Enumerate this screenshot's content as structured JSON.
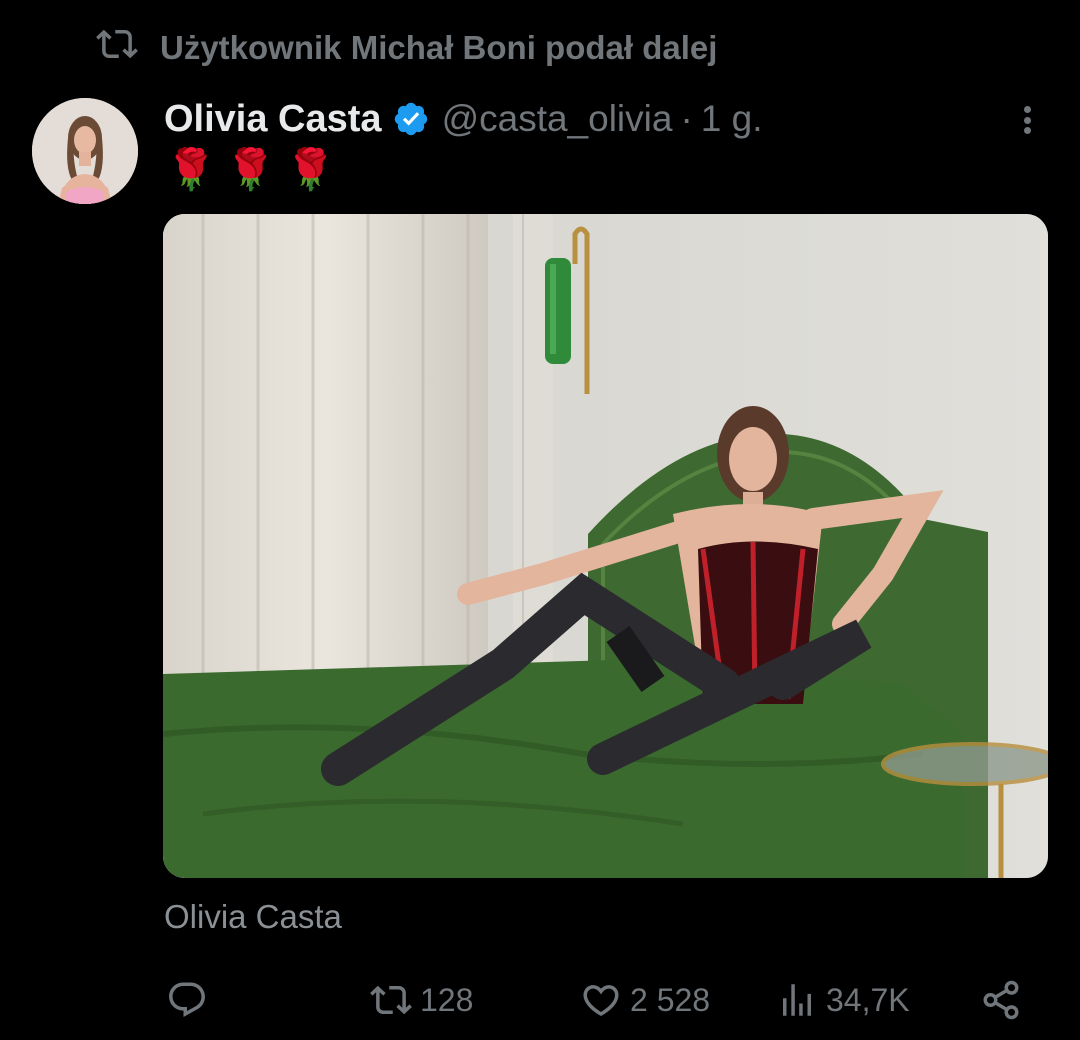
{
  "retweet": {
    "icon": "retweet-icon",
    "label": "Użytkownik Michał Boni podał dalej"
  },
  "tweet": {
    "author_name": "Olivia Casta",
    "handle": "@casta_olivia",
    "separator": "·",
    "time": "1 g.",
    "text_emoji": [
      "🌹",
      "🌹",
      "🌹"
    ],
    "media_caption": "Olivia Casta"
  },
  "actions": {
    "reply": {
      "icon": "reply-icon",
      "count": ""
    },
    "retweet": {
      "icon": "retweet-icon",
      "count": "128"
    },
    "like": {
      "icon": "heart-icon",
      "count": "2 528"
    },
    "views": {
      "icon": "views-icon",
      "count": "34,7K"
    },
    "share": {
      "icon": "share-icon"
    }
  },
  "colors": {
    "background": "#000000",
    "primary_text": "#e7e9ea",
    "secondary_text": "#71767b",
    "verified_badge": "#1d9bf0",
    "bed_green": "#3f6a32"
  }
}
